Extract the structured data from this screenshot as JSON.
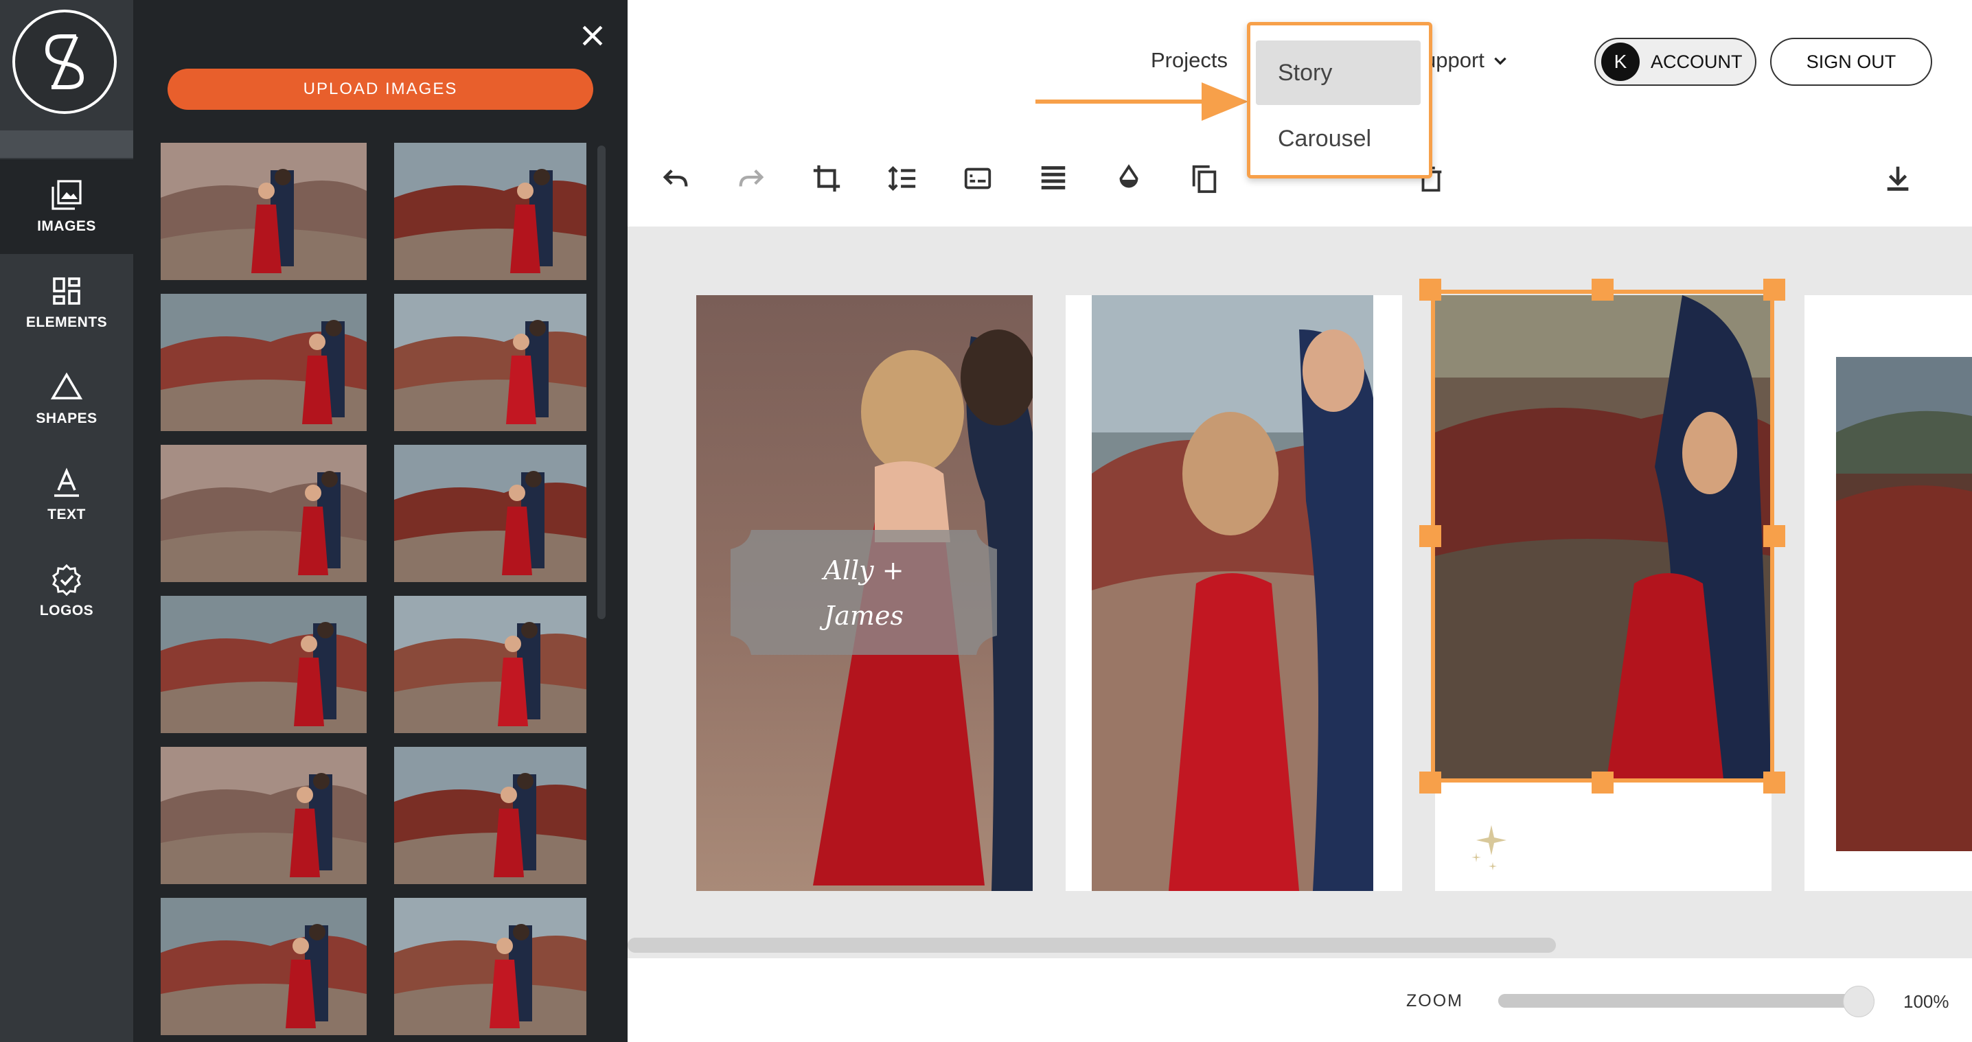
{
  "sidebar": {
    "items": [
      {
        "label": "IMAGES",
        "icon": "images-icon",
        "active": true
      },
      {
        "label": "ELEMENTS",
        "icon": "elements-icon",
        "active": false
      },
      {
        "label": "SHAPES",
        "icon": "shapes-icon",
        "active": false
      },
      {
        "label": "TEXT",
        "icon": "text-icon",
        "active": false
      },
      {
        "label": "LOGOS",
        "icon": "logos-icon",
        "active": false
      }
    ]
  },
  "panel": {
    "upload_label": "UPLOAD IMAGES",
    "thumbnail_count": 12
  },
  "nav": {
    "projects_label": "Projects",
    "support_label": "upport",
    "account_initial": "K",
    "account_label": "ACCOUNT",
    "signout_label": "SIGN OUT"
  },
  "dropdown": {
    "options": [
      "Story",
      "Carousel"
    ],
    "hovered": "Story"
  },
  "canvas": {
    "overlay_text_line1": "Ally +",
    "overlay_text_line2": "James"
  },
  "zoom": {
    "label": "ZOOM",
    "value": "100%",
    "fraction": 1.0
  },
  "colors": {
    "accent": "#e85f2c",
    "selection": "#f7a04a",
    "rail_bg": "#34383c",
    "panel_bg": "#222528",
    "canvas_bg": "#e8e8e8"
  }
}
